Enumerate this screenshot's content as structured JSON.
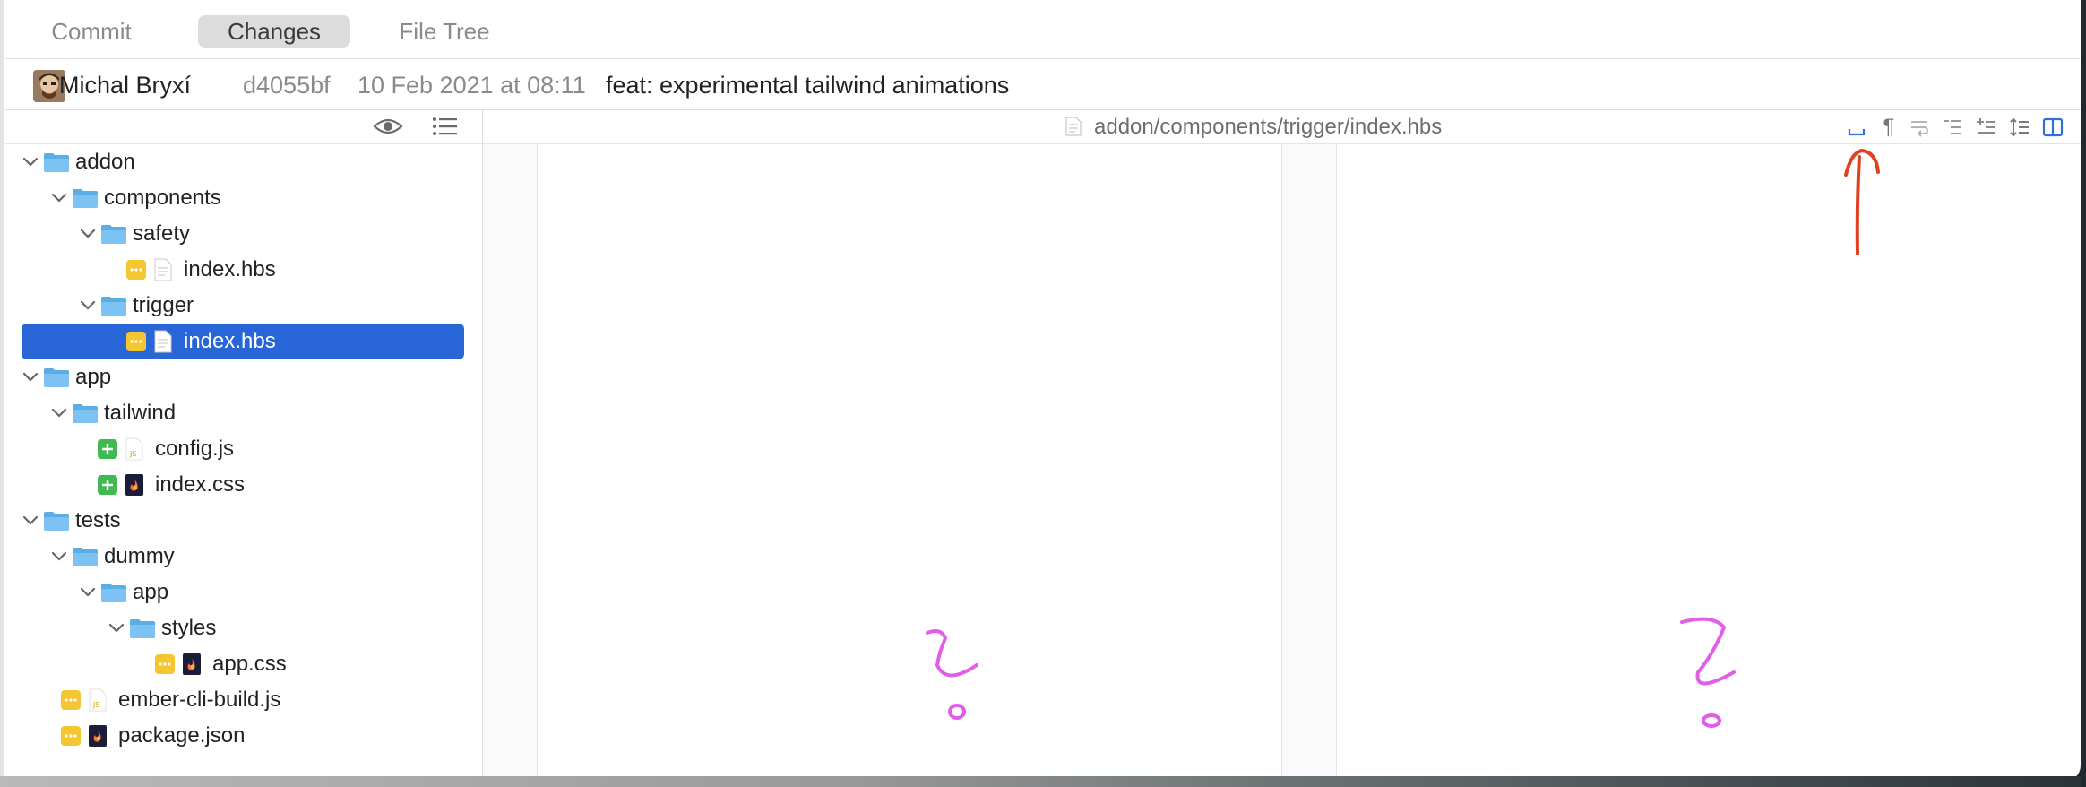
{
  "tabs": [
    {
      "label": "Commit",
      "active": false
    },
    {
      "label": "Changes",
      "active": true
    },
    {
      "label": "File Tree",
      "active": false
    }
  ],
  "commit": {
    "author": "Michal Bryxí",
    "hash": "d4055bf",
    "date": "10 Feb 2021 at 08:11",
    "message": "feat: experimental tailwind animations"
  },
  "sidebar_toolbar": {
    "icons": [
      "eye-icon",
      "list-icon"
    ]
  },
  "tree": [
    {
      "label": "addon",
      "type": "folder",
      "expanded": true,
      "depth": 0
    },
    {
      "label": "components",
      "type": "folder",
      "expanded": true,
      "depth": 1
    },
    {
      "label": "safety",
      "type": "folder",
      "expanded": true,
      "depth": 2
    },
    {
      "label": "index.hbs",
      "type": "file",
      "status": "modified",
      "depth": 3,
      "icon": "text-file-icon"
    },
    {
      "label": "trigger",
      "type": "folder",
      "expanded": true,
      "depth": 2
    },
    {
      "label": "index.hbs",
      "type": "file",
      "status": "modified",
      "depth": 3,
      "icon": "text-file-icon",
      "selected": true
    },
    {
      "label": "app",
      "type": "folder",
      "expanded": true,
      "depth": 0
    },
    {
      "label": "tailwind",
      "type": "folder",
      "expanded": true,
      "depth": 1
    },
    {
      "label": "config.js",
      "type": "file",
      "status": "added",
      "depth": 2,
      "icon": "js-file-icon"
    },
    {
      "label": "index.css",
      "type": "file",
      "status": "added",
      "depth": 2,
      "icon": "css-file-icon"
    },
    {
      "label": "tests",
      "type": "folder",
      "expanded": true,
      "depth": 0
    },
    {
      "label": "dummy",
      "type": "folder",
      "expanded": true,
      "depth": 1
    },
    {
      "label": "app",
      "type": "folder",
      "expanded": true,
      "depth": 2
    },
    {
      "label": "styles",
      "type": "folder",
      "expanded": true,
      "depth": 3
    },
    {
      "label": "app.css",
      "type": "file",
      "status": "modified",
      "depth": 4,
      "icon": "css-file-icon"
    },
    {
      "label": "ember-cli-build.js",
      "type": "file",
      "status": "modified",
      "depth": 0,
      "icon": "js-file-icon"
    },
    {
      "label": "package.json",
      "type": "file",
      "status": "modified",
      "depth": 0,
      "icon": "css-file-icon"
    }
  ],
  "diff": {
    "file_path": "addon/components/trigger/index.hbs",
    "toolbar_icons": [
      "whitespace-icon",
      "pilcrow-icon",
      "wrap-icon",
      "decrease-context-icon",
      "increase-context-icon",
      "expand-context-icon",
      "split-view-icon"
    ]
  },
  "colors": {
    "selection": "#2866d8",
    "modified_badge": "#f4c632",
    "added_badge": "#3fb950",
    "folder": "#5aaee8",
    "annotation_red": "#e0401f",
    "annotation_magenta": "#e15ee8"
  }
}
